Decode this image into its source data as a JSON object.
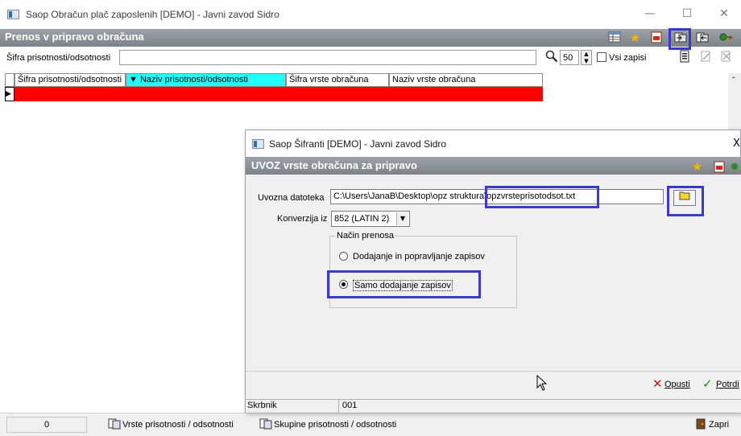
{
  "main_window": {
    "title": "Saop Obračun plač zaposlenih [DEMO] - Javni zavod Sidro",
    "controls": {
      "minimize": "—",
      "maximize": "☐",
      "close": "✕"
    }
  },
  "header": {
    "title": "Prenos v pripravo obračuna",
    "toolbar_icons": [
      "table-icon",
      "star-icon",
      "pdf-icon",
      "import-icon",
      "export-icon",
      "key-icon"
    ]
  },
  "filter": {
    "label": "Šifra prisotnosti/odsotnosti",
    "value": "",
    "limit": "50",
    "all_records_label": "Vsi zapisi",
    "all_records_checked": false
  },
  "grid": {
    "columns": [
      "Šifra prisotnosti/odsotnosti",
      "▼ Naziv prisotnosti/odsotnosti",
      "Šifra vrste obračuna",
      "Naziv vrste obračuna"
    ],
    "row_indicator": "▶"
  },
  "statusbar": {
    "count": "0",
    "link1": "Vrste prisotnosti / odsotnosti",
    "link2": "Skupine prisotnosti / odsotnosti",
    "close": "Zapri"
  },
  "dialog": {
    "title": "Saop Šifranti [DEMO] - Javni zavod Sidro",
    "close_glyph": "X",
    "header": "UVOZ vrste obračuna za pripravo",
    "file_label": "Uvozna datoteka",
    "file_value": "C:\\Users\\JanaB\\Desktop\\opz struktura\\opzvrsteprisotodsot.txt",
    "conversion_label": "Konverzija iz",
    "conversion_value": "852 (LATIN 2)",
    "mode_group_label": "Način prenosa",
    "option_add_update": "Dodajanje in popravljanje zapisov",
    "option_add_only": "Samo dodajanje zapisov",
    "selected_option": "add_only",
    "cancel_label": "Opusti",
    "confirm_label": "Potrdi",
    "status_label": "Skrbnik",
    "status_value": "001"
  },
  "colors": {
    "header_gray": "#8a8f95",
    "selected_row": "#ff0000",
    "active_column": "#22ffff",
    "highlight": "#3a3ac8"
  }
}
